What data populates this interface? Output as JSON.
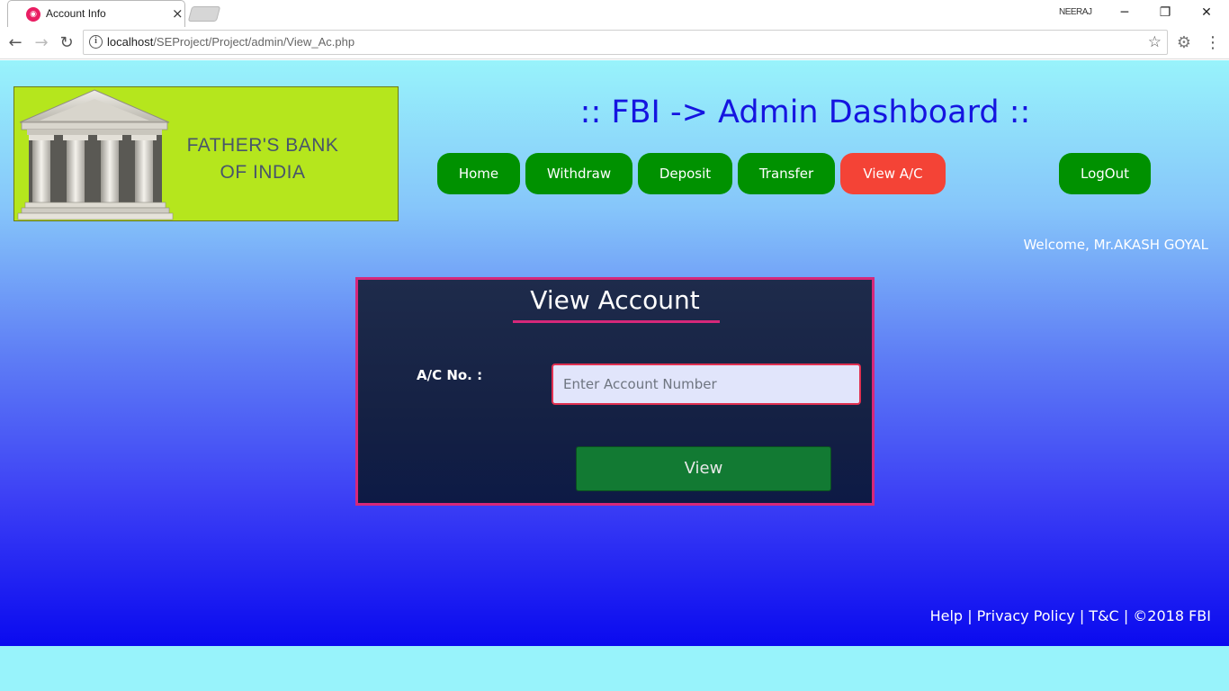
{
  "browser": {
    "tab_title": "Account Info",
    "tab_close": "×",
    "profile_name": "NEERAJ",
    "url_host": "localhost",
    "url_path": "/SEProject/Project/admin/View_Ac.php",
    "minimize": "─",
    "restore": "❐",
    "close": "✕",
    "back": "←",
    "forward": "→",
    "reload": "↻",
    "info": "i",
    "star": "☆",
    "extension": "⚙",
    "menu": "⋮"
  },
  "logo": {
    "line1": "FATHER'S BANK",
    "line2": "OF INDIA"
  },
  "header": {
    "title": ":: FBI -> Admin Dashboard ::"
  },
  "nav": {
    "home": "Home",
    "withdraw": "Withdraw",
    "deposit": "Deposit",
    "transfer": "Transfer",
    "view_ac": "View A/C",
    "logout": "LogOut"
  },
  "welcome": "Welcome, Mr.AKASH GOYAL",
  "form": {
    "title": "View Account",
    "ac_label": "A/C No. :",
    "ac_placeholder": "Enter Account Number",
    "ac_value": "",
    "submit": "View"
  },
  "footer": {
    "help": "Help",
    "privacy": "Privacy Policy",
    "tc": "T&C",
    "copyright": "©2018 FBI",
    "separator": "|"
  },
  "colors": {
    "nav_green": "#009100",
    "nav_active": "#f44336",
    "accent_pink": "#d6287a",
    "title_blue": "#1515e0",
    "logo_bg": "#b5e61d"
  }
}
